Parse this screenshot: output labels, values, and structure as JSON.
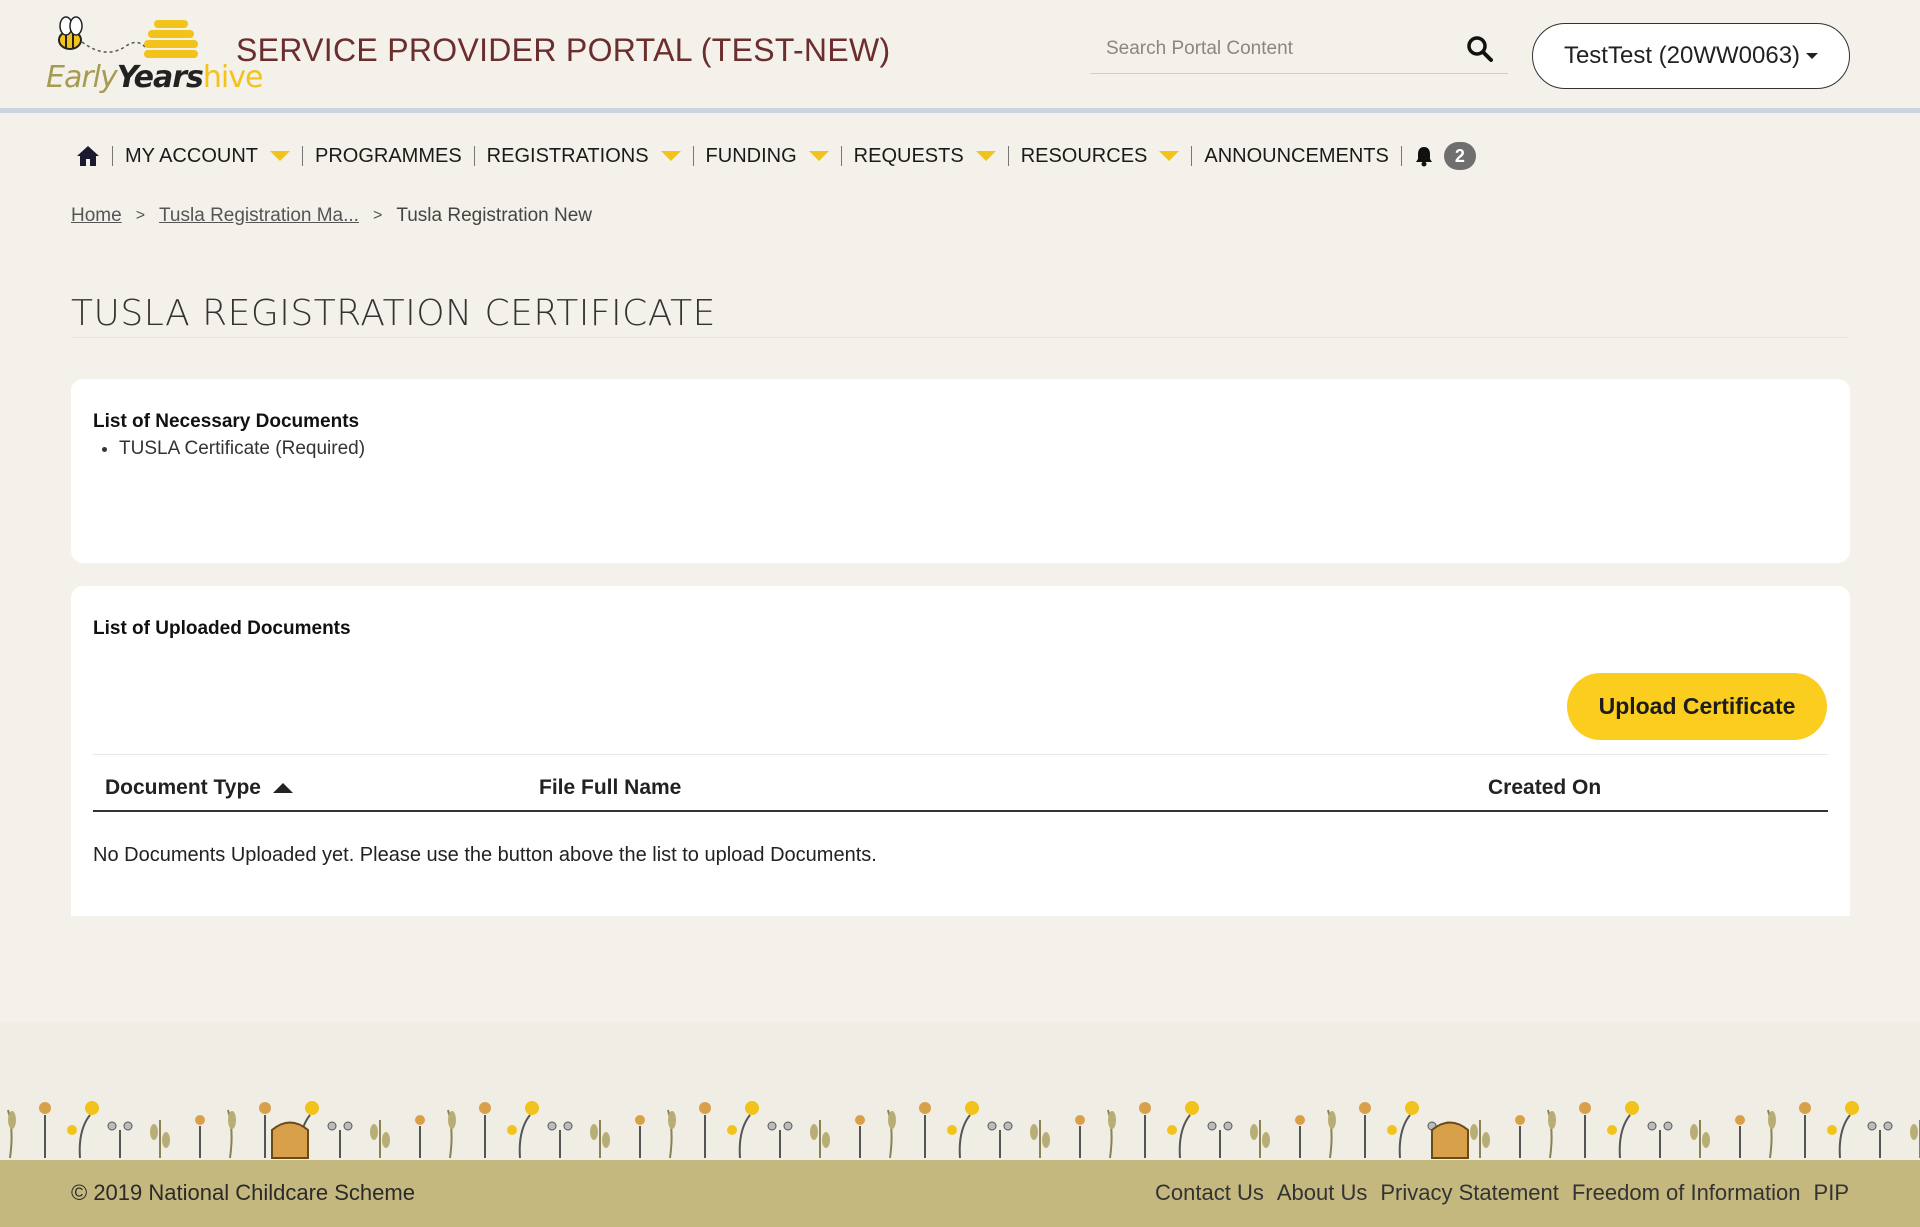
{
  "header": {
    "logo_parts": {
      "early": "Early",
      "years": "Years",
      "hive": "hive"
    },
    "portal_title": "SERVICE PROVIDER PORTAL (TEST-NEW)",
    "search_placeholder": "Search Portal Content",
    "account_label": "TestTest (20WW0063)"
  },
  "nav": {
    "items": [
      {
        "label": "MY ACCOUNT",
        "dropdown": true
      },
      {
        "label": "PROGRAMMES",
        "dropdown": false
      },
      {
        "label": "REGISTRATIONS",
        "dropdown": true
      },
      {
        "label": "FUNDING",
        "dropdown": true
      },
      {
        "label": "REQUESTS",
        "dropdown": true
      },
      {
        "label": "RESOURCES",
        "dropdown": true
      },
      {
        "label": "ANNOUNCEMENTS",
        "dropdown": false
      }
    ],
    "notification_count": "2"
  },
  "breadcrumb": {
    "home": "Home",
    "parent": "Tusla Registration Ma...",
    "current": "Tusla Registration New",
    "separator": ">"
  },
  "page": {
    "title": "TUSLA REGISTRATION CERTIFICATE"
  },
  "necessary_docs": {
    "heading": "List of Necessary Documents",
    "items": [
      "TUSLA Certificate (Required)"
    ]
  },
  "uploaded_docs": {
    "heading": "List of Uploaded Documents",
    "upload_button": "Upload Certificate",
    "columns": [
      "Document Type",
      "File Full Name",
      "Created On"
    ],
    "empty_message": "No Documents Uploaded yet. Please use the button above the list to upload Documents."
  },
  "footer": {
    "copyright": "© 2019 National Childcare Scheme",
    "links": [
      "Contact Us",
      "About Us",
      "Privacy Statement",
      "Freedom of Information",
      "PIP"
    ]
  },
  "colors": {
    "accent_yellow": "#fbcd1f",
    "title_maroon": "#6b2d2d",
    "footer_bar": "#c4b87f",
    "page_bg": "#f3f1ea"
  }
}
